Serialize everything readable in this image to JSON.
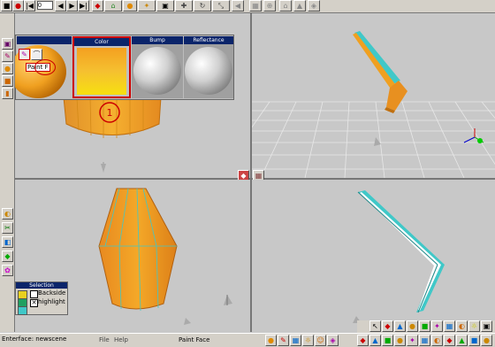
{
  "toolbar": {
    "frame_value": "0",
    "icons": [
      "stop-icon",
      "record-icon",
      "rewind-icon",
      "step-back-icon",
      "play-icon",
      "step-forward-icon",
      "fast-forward-icon",
      "render-icon",
      "object-icon",
      "paint-icon",
      "light-icon",
      "camera-icon",
      "move-icon",
      "rotate-icon",
      "scale-icon",
      "home-icon",
      "forward-icon",
      "view-icon"
    ]
  },
  "materials": {
    "slots": [
      {
        "label": "",
        "kind": "sphere-orange"
      },
      {
        "label": "Color",
        "kind": "color"
      },
      {
        "label": "Bump",
        "kind": "sphere-grey"
      },
      {
        "label": "Reflectance",
        "kind": "sphere-grey"
      }
    ],
    "paint_tool_label": "Paint F"
  },
  "annotation": {
    "marker": "1"
  },
  "selection_panel": {
    "title": "Selection",
    "options": [
      {
        "label": "Backside",
        "checked": false
      },
      {
        "label": "highlight",
        "checked": true
      }
    ]
  },
  "statusbar": {
    "status_text": "Enterface: newscene",
    "menu": [
      "File",
      "Help"
    ],
    "mode_text": "Paint Face"
  },
  "colors": {
    "viewport_bg": "#c8c8c8",
    "accent_red": "#cc0000",
    "mesh_orange": "#f0a020",
    "edge_cyan": "#40c8c8"
  }
}
